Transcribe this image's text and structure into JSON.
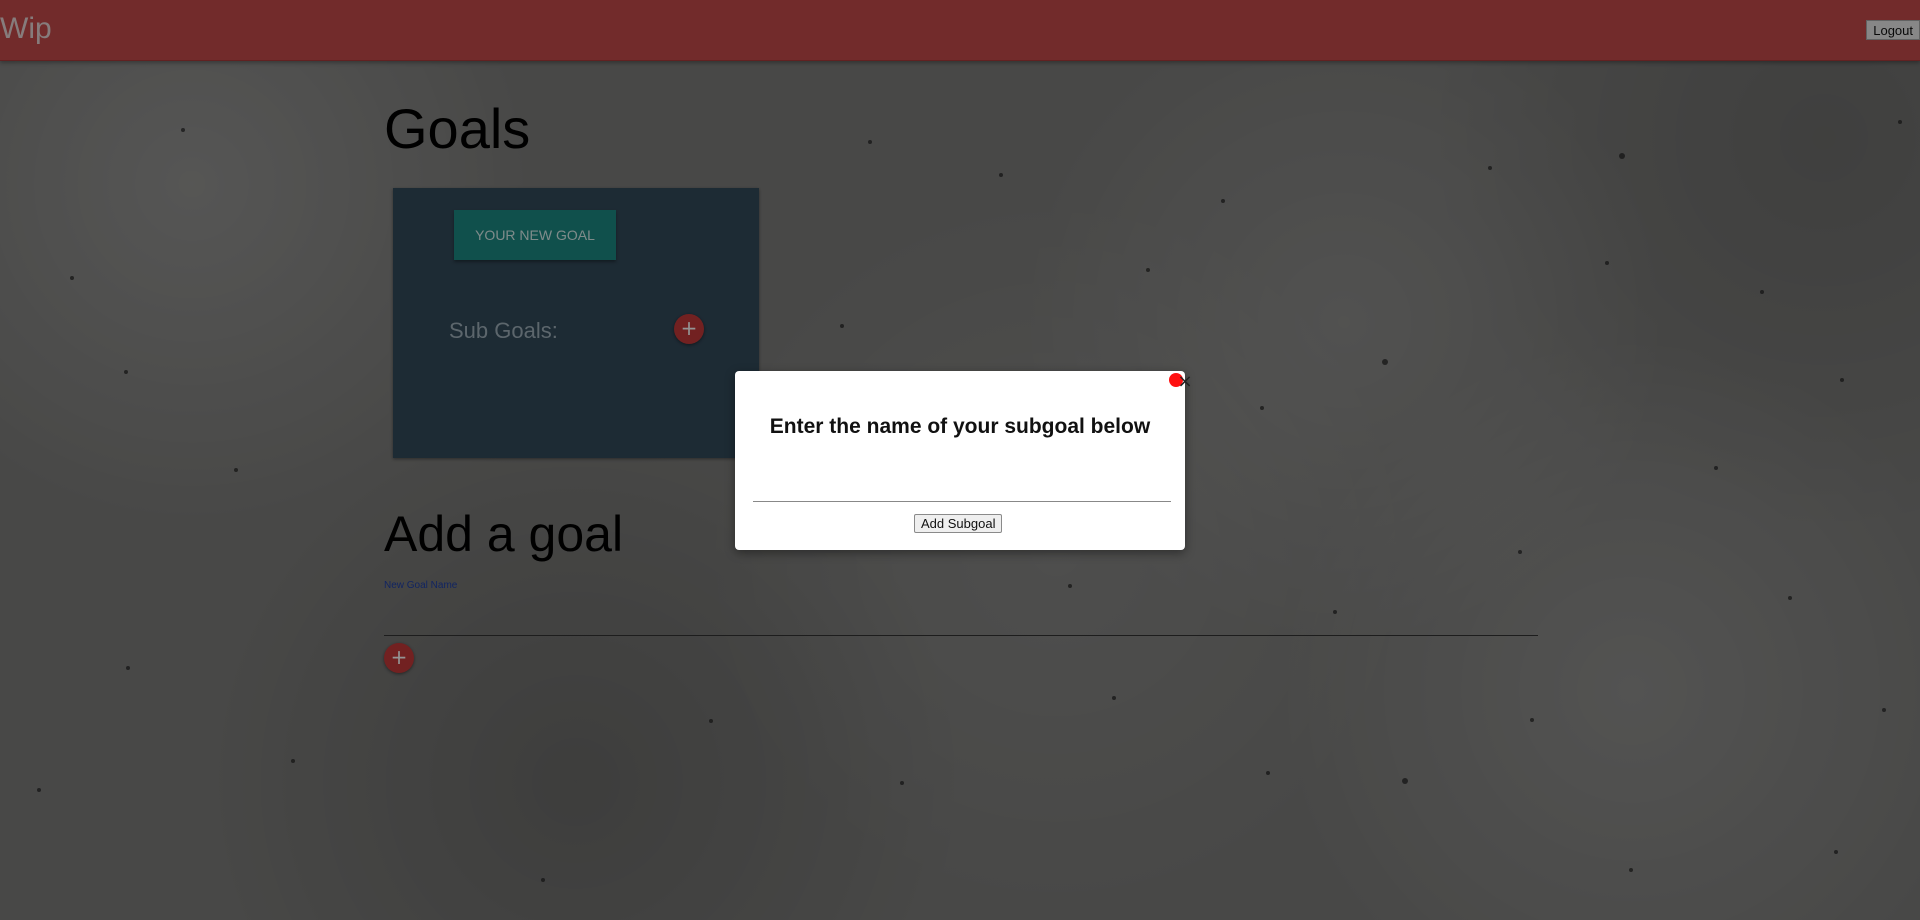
{
  "navbar": {
    "brand": "Wip",
    "logout_label": "Logout"
  },
  "main": {
    "title": "Goals",
    "goals": [
      {
        "name": "YOUR NEW GOAL",
        "subgoals_label": "Sub Goals:",
        "add_subgoal_icon": "+"
      }
    ],
    "add_goal": {
      "title": "Add a goal",
      "field_label": "New Goal Name",
      "input_value": "",
      "add_icon": "+"
    }
  },
  "modal": {
    "title": "Enter the name of your subgoal below",
    "input_value": "",
    "submit_label": "Add Subgoal",
    "close_icon": "×"
  },
  "colors": {
    "navbar": "#c44a4a",
    "card": "#334a5a",
    "goal_button": "#1d8a84",
    "fab": "#c53a3a",
    "close_dot": "#ff1010"
  }
}
